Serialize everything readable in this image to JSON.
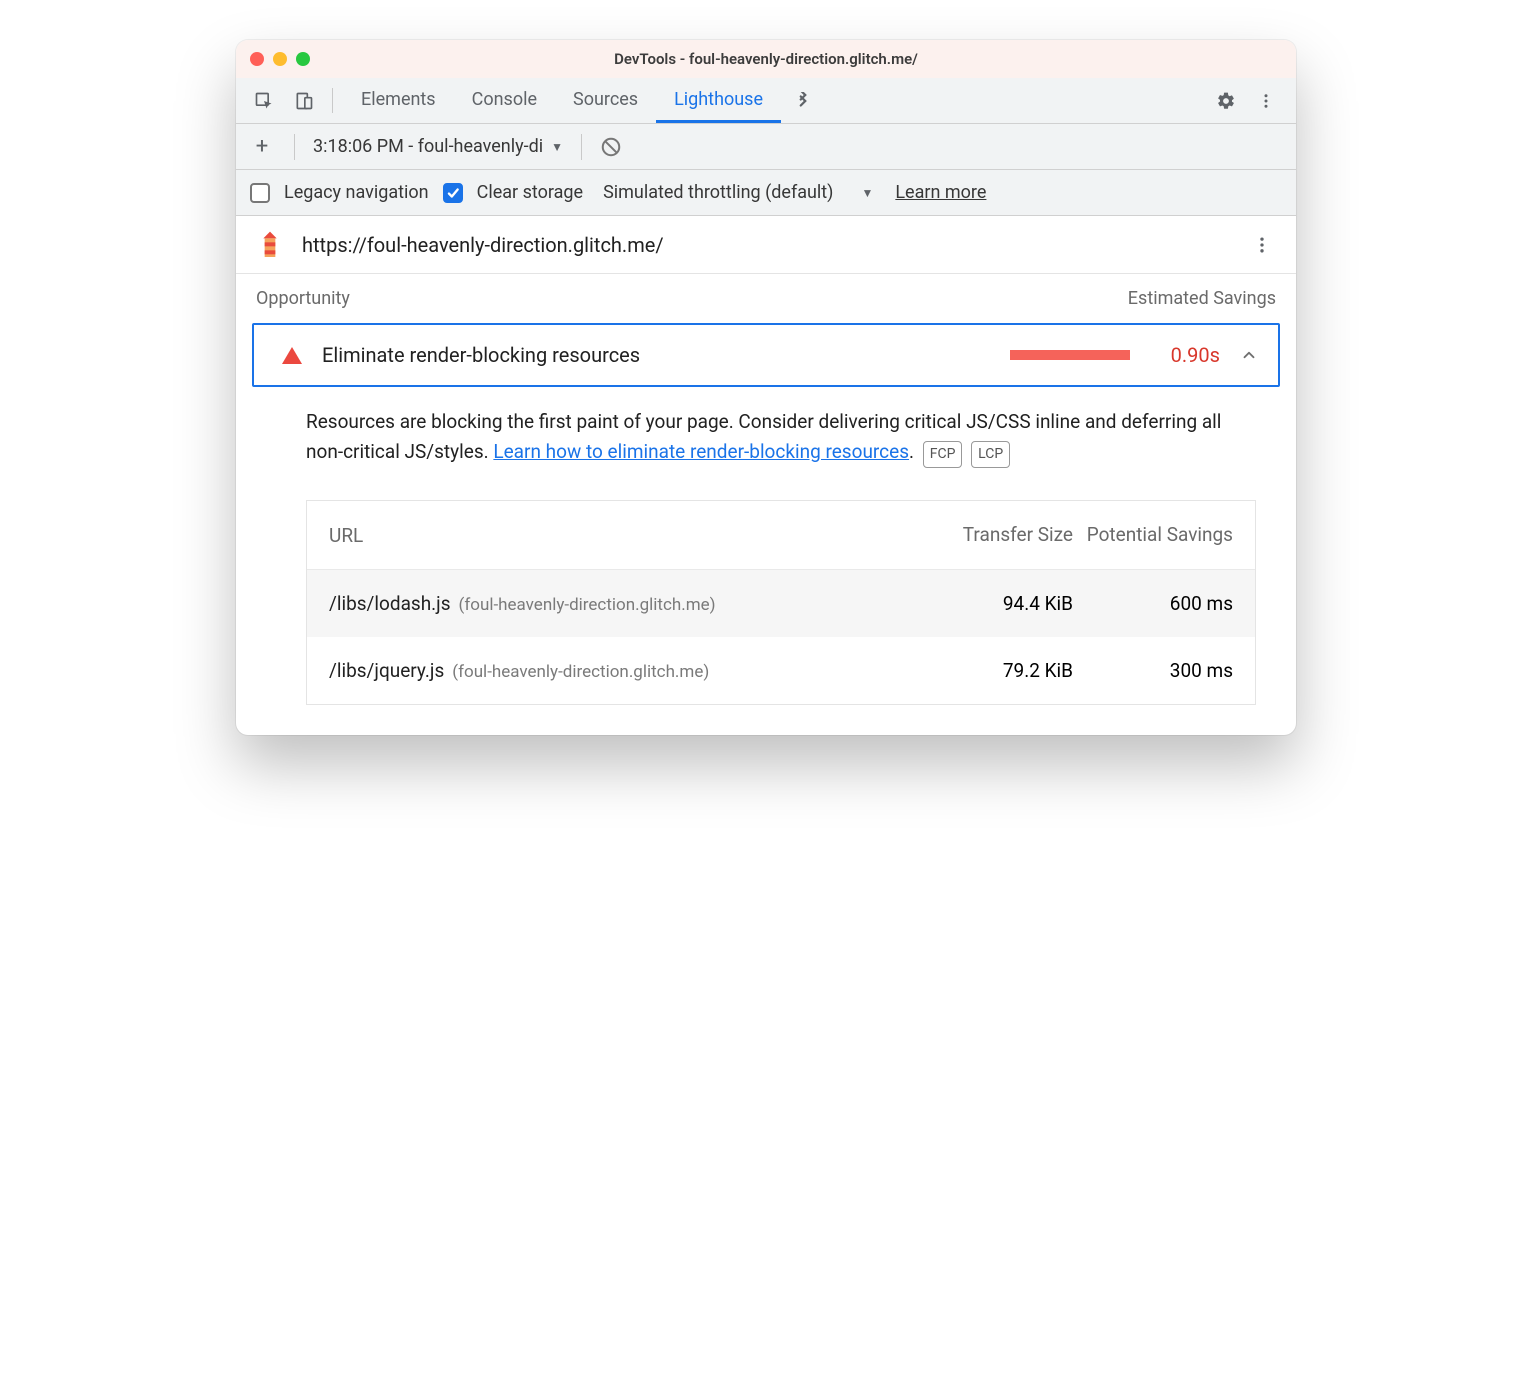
{
  "window": {
    "title": "DevTools - foul-heavenly-direction.glitch.me/"
  },
  "tabbar": {
    "tabs": [
      "Elements",
      "Console",
      "Sources",
      "Lighthouse"
    ],
    "activeIndex": 3
  },
  "subbar": {
    "plus": "+",
    "report_label": "3:18:06 PM - foul-heavenly-di"
  },
  "optbar": {
    "legacy_label": "Legacy navigation",
    "legacy_checked": false,
    "clear_label": "Clear storage",
    "clear_checked": true,
    "throttling_label": "Simulated throttling (default)",
    "learn_more": "Learn more"
  },
  "urlrow": {
    "url": "https://foul-heavenly-direction.glitch.me/"
  },
  "section": {
    "left_header": "Opportunity",
    "right_header": "Estimated Savings"
  },
  "opportunity": {
    "title": "Eliminate render-blocking resources",
    "value": "0.90s",
    "desc_a": "Resources are blocking the first paint of your page. Consider delivering critical JS/CSS inline and deferring all non-critical JS/styles. ",
    "desc_link": "Learn how to eliminate render-blocking resources",
    "desc_b": ".",
    "badges": [
      "FCP",
      "LCP"
    ],
    "table": {
      "headers": {
        "url": "URL",
        "size": "Transfer Size",
        "savings": "Potential Savings"
      },
      "rows": [
        {
          "path": "/libs/lodash.js",
          "origin": "(foul-heavenly-direction.glitch.me)",
          "size": "94.4 KiB",
          "savings": "600 ms"
        },
        {
          "path": "/libs/jquery.js",
          "origin": "(foul-heavenly-direction.glitch.me)",
          "size": "79.2 KiB",
          "savings": "300 ms"
        }
      ]
    }
  }
}
